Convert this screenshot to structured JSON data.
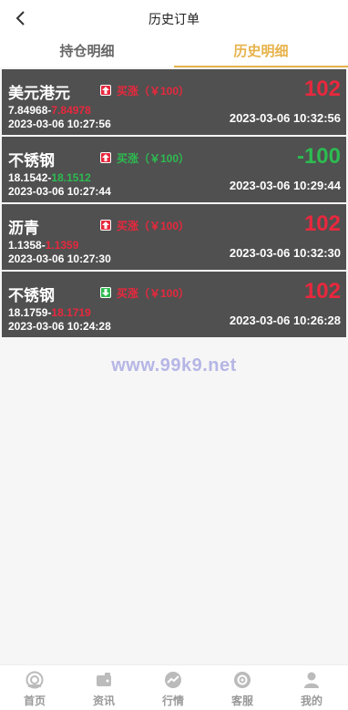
{
  "header": {
    "title": "历史订单"
  },
  "tabs": [
    {
      "label": "持仓明细",
      "active": false
    },
    {
      "label": "历史明细",
      "active": true
    }
  ],
  "colors": {
    "accent": "#e7b24a",
    "up": "#e8283d",
    "down": "#2dbb51",
    "card_bg": "#505050"
  },
  "orders": [
    {
      "name": "美元港元",
      "direction": "up",
      "direction_label": "买涨（￥100）",
      "direction_color": "#e8283d",
      "open_price": "7.84968",
      "close_price": "7.84978",
      "close_price_color": "#e8283d",
      "open_time": "2023-03-06 10:27:56",
      "profit": "102",
      "profit_color": "#e8283d",
      "close_time": "2023-03-06 10:32:56"
    },
    {
      "name": "不锈钢",
      "direction": "up",
      "direction_label": "买涨（￥100）",
      "direction_color": "#2dbb51",
      "open_price": "18.1542",
      "close_price": "18.1512",
      "close_price_color": "#2dbb51",
      "open_time": "2023-03-06 10:27:44",
      "profit": "-100",
      "profit_color": "#2dbb51",
      "close_time": "2023-03-06 10:29:44"
    },
    {
      "name": "沥青",
      "direction": "up",
      "direction_label": "买涨（￥100）",
      "direction_color": "#e8283d",
      "open_price": "1.1358",
      "close_price": "1.1359",
      "close_price_color": "#e8283d",
      "open_time": "2023-03-06 10:27:30",
      "profit": "102",
      "profit_color": "#e8283d",
      "close_time": "2023-03-06 10:32:30"
    },
    {
      "name": "不锈钢",
      "direction": "down",
      "direction_label": "买涨（￥100）",
      "direction_color": "#e8283d",
      "open_price": "18.1759",
      "close_price": "18.1719",
      "close_price_color": "#e8283d",
      "open_time": "2023-03-06 10:24:28",
      "profit": "102",
      "profit_color": "#e8283d",
      "close_time": "2023-03-06 10:26:28"
    }
  ],
  "watermark": "www.99k9.net",
  "tabbar": [
    {
      "label": "首页",
      "icon": "home-icon"
    },
    {
      "label": "资讯",
      "icon": "wallet-icon"
    },
    {
      "label": "行情",
      "icon": "chart-icon"
    },
    {
      "label": "客服",
      "icon": "service-icon"
    },
    {
      "label": "我的",
      "icon": "user-icon"
    }
  ]
}
